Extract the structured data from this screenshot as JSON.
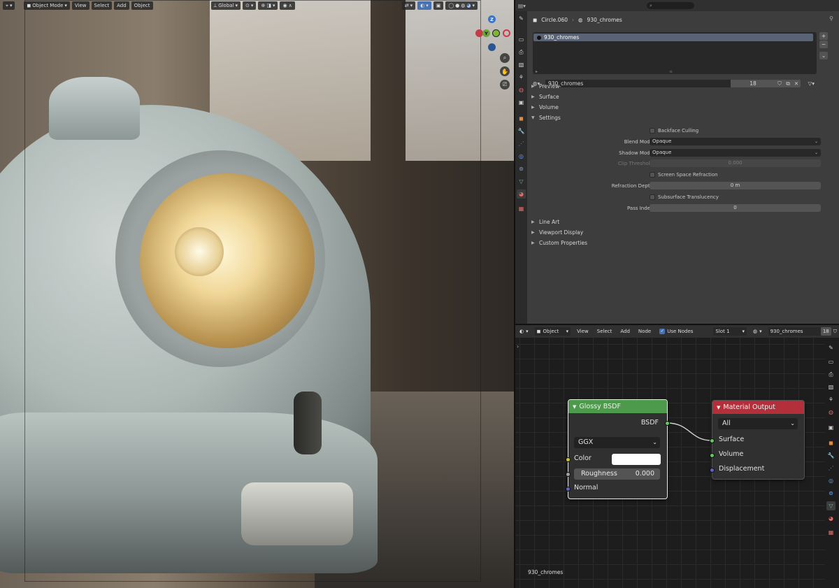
{
  "viewport": {
    "mode_label": "Object Mode",
    "menus": [
      "View",
      "Select",
      "Add",
      "Object"
    ],
    "orientation_label": "Global",
    "gizmo_axes": [
      "X",
      "Y",
      "Z"
    ]
  },
  "properties": {
    "breadcrumb_object": "Circle.060",
    "breadcrumb_material": "930_chromes",
    "slot_name": "930_chromes",
    "material_name": "930_chromes",
    "user_count": "18",
    "sections_top": [
      "Preview",
      "Surface",
      "Volume",
      "Settings"
    ],
    "settings": {
      "backface_culling": "Backface Culling",
      "blend_mode_label": "Blend Mode",
      "blend_mode_value": "Opaque",
      "shadow_mode_label": "Shadow Mode",
      "shadow_mode_value": "Opaque",
      "clip_threshold_label": "Clip Threshold",
      "clip_threshold_value": "0.000",
      "ssr_label": "Screen Space Refraction",
      "refraction_depth_label": "Refraction Depth",
      "refraction_depth_value": "0 m",
      "subsurface_label": "Subsurface Translucency",
      "pass_index_label": "Pass Index",
      "pass_index_value": "0"
    },
    "sections_bottom": [
      "Line Art",
      "Viewport Display",
      "Custom Properties"
    ]
  },
  "node_editor": {
    "header": {
      "object_label": "Object",
      "menus": [
        "View",
        "Select",
        "Add",
        "Node"
      ],
      "use_nodes_label": "Use Nodes",
      "slot_label": "Slot 1",
      "material_name": "930_chromes",
      "user_count": "18"
    },
    "glossy": {
      "title": "Glossy BSDF",
      "output": "BSDF",
      "distribution": "GGX",
      "color_label": "Color",
      "roughness_label": "Roughness",
      "roughness_value": "0.000",
      "normal_label": "Normal"
    },
    "output": {
      "title": "Material Output",
      "target": "All",
      "surface": "Surface",
      "volume": "Volume",
      "displacement": "Displacement"
    },
    "footer_material": "930_chromes",
    "colors": {
      "glossy_header": "#4d9a4d",
      "output_header": "#b3303a",
      "shader_socket": "#63c763",
      "float_socket": "#a1a1a1",
      "color_socket": "#c7c729",
      "vector_socket": "#6363c7"
    }
  }
}
